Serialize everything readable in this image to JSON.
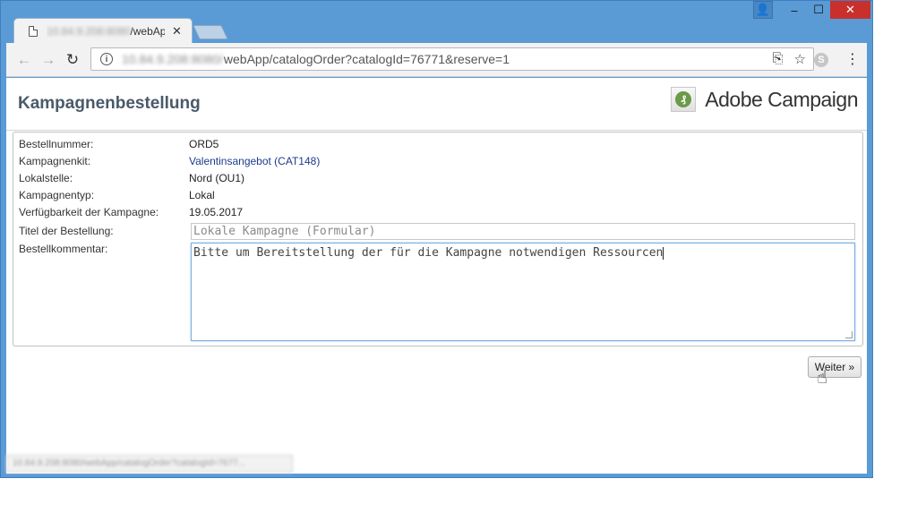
{
  "browser": {
    "tab": {
      "title_blurred": "10.84.9.208:8080",
      "title": "/webAp",
      "close_glyph": "✕"
    },
    "window_controls": {
      "user": "👤",
      "minimize": "–",
      "maximize": "☐",
      "close": "✕"
    },
    "toolbar": {
      "back": "←",
      "forward": "→",
      "reload": "↻",
      "url_blurred": "10.84.9.208:8080/",
      "url": "webApp/catalogOrder?catalogId=76771&reserve=1",
      "info": "i",
      "translate_icon": "⎘",
      "star_icon": "☆",
      "skype_icon": "S",
      "menu_icon": "⋮"
    },
    "status_url": "10.84.9.208:8080/webApp/catalogOrder?catalogId=7677..."
  },
  "page": {
    "title": "Kampagnenbestellung",
    "brand": {
      "logo_glyph": "₰",
      "name": "Adobe Campaign"
    },
    "fields": {
      "order_number": {
        "label": "Bestellnummer:",
        "value": "ORD5"
      },
      "kit": {
        "label": "Kampagnenkit:",
        "value": "Valentinsangebot (CAT148)"
      },
      "local_entity": {
        "label": "Lokalstelle:",
        "value": "Nord (OU1)"
      },
      "campaign_type": {
        "label": "Kampagnentyp:",
        "value": "Lokal"
      },
      "availability": {
        "label": "Verfügbarkeit der Kampagne:",
        "value": "19.05.2017"
      },
      "order_title": {
        "label": "Titel der Bestellung:",
        "placeholder": "Lokale Kampagne (Formular)"
      },
      "order_comment": {
        "label": "Bestellkommentar:",
        "value": "Bitte um Bereitstellung der für die Kampagne notwendigen Ressourcen"
      }
    },
    "next_label": "Weiter »",
    "cursor": "☝"
  }
}
